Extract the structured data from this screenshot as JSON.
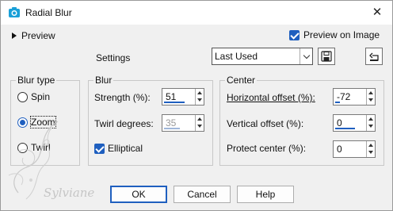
{
  "window": {
    "title": "Radial Blur",
    "close_icon": "close-icon"
  },
  "preview": {
    "label": "Preview",
    "preview_on_image_label": "Preview on Image",
    "preview_on_image_checked": true
  },
  "settings": {
    "label": "Settings",
    "preset_value": "Last Used"
  },
  "blur_type": {
    "title": "Blur type",
    "options": [
      {
        "label": "Spin",
        "selected": false
      },
      {
        "label": "Zoom",
        "selected": true
      },
      {
        "label": "Twirl",
        "selected": false
      }
    ]
  },
  "blur": {
    "title": "Blur",
    "strength": {
      "label": "Strength (%):",
      "value": "51",
      "fill": 0.51
    },
    "twirl": {
      "label": "Twirl degrees:",
      "value": "35",
      "fill": 0.39,
      "disabled": true
    },
    "elliptical": {
      "label": "Elliptical",
      "checked": true
    }
  },
  "center": {
    "title": "Center",
    "horizontal": {
      "label": "Horizontal offset (%):",
      "value": "-72",
      "fill": 0.14
    },
    "vertical": {
      "label": "Vertical offset (%):",
      "value": "0",
      "fill": 0.5
    },
    "protect": {
      "label": "Protect center (%):",
      "value": "0",
      "fill": 0.0
    }
  },
  "buttons": {
    "ok": "OK",
    "cancel": "Cancel",
    "help": "Help"
  },
  "watermark": {
    "text": "Sylviane"
  },
  "colors": {
    "accent": "#1f5fbf",
    "background": "#f0f0f0"
  }
}
